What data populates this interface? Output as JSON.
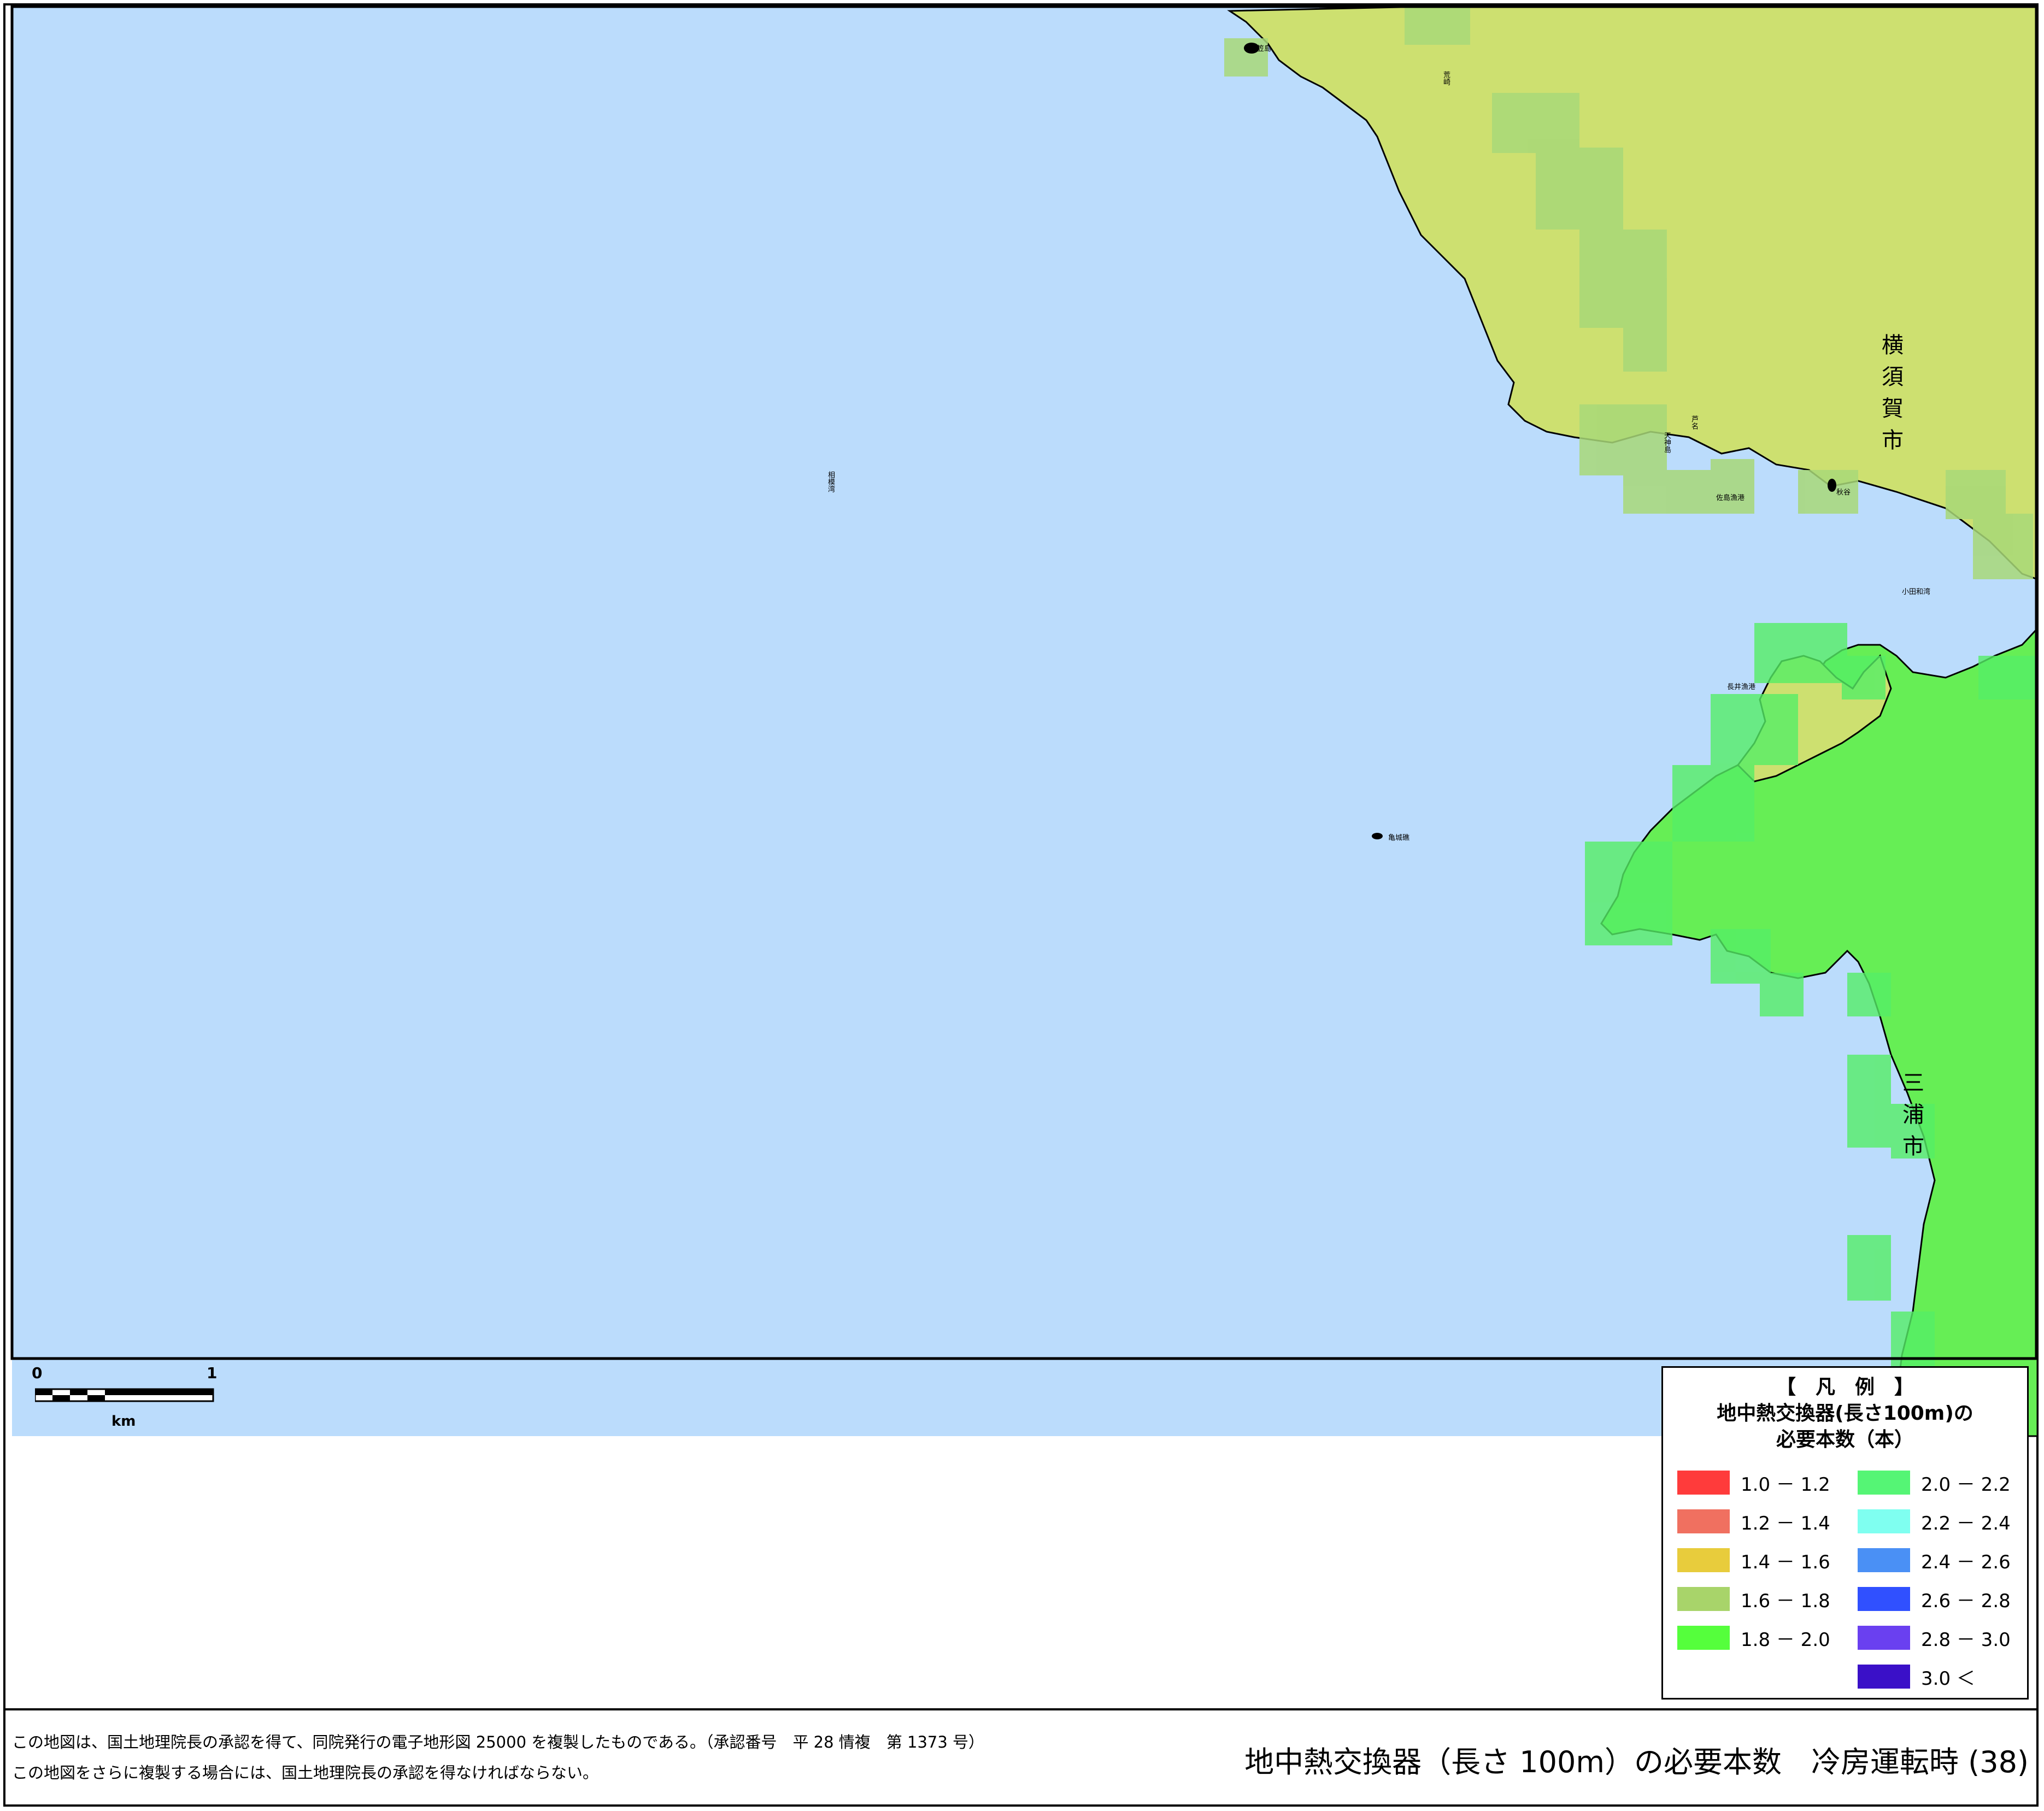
{
  "map": {
    "colors": {
      "sea": "#bbdcfc",
      "zone_1_6_1_8": "#cde070",
      "zone_1_8_2_0": "#66ee55",
      "zone_grid_1_6_1_8": "#a8d878",
      "zone_grid_1_8_2_0": "#55ee66",
      "outline": "#000000"
    },
    "place_labels": [
      "笠島",
      "荒崎",
      "亀城礁",
      "長井漁港",
      "佐島漁港",
      "天神島",
      "芦名",
      "相模湾",
      "小田和湾",
      "秋谷",
      "三浦市"
    ],
    "city_label_yokosuka": "横須賀市",
    "city_label_miura": "三浦市"
  },
  "scale_bar": {
    "tick_start": "0",
    "tick_end": "1",
    "unit": "km"
  },
  "legend": {
    "heading": "【　凡　例　】",
    "title_line1": "地中熱交換器(長さ100m)の",
    "title_line2": "必要本数（本）",
    "items": [
      {
        "range": "1.0 － 1.2",
        "color": "#ff3b3b"
      },
      {
        "range": "1.2 － 1.4",
        "color": "#f07060"
      },
      {
        "range": "1.4 － 1.6",
        "color": "#e8cc3c"
      },
      {
        "range": "1.6 － 1.8",
        "color": "#a8d46a"
      },
      {
        "range": "1.8 － 2.0",
        "color": "#55ff3c"
      },
      {
        "range": "2.0 － 2.2",
        "color": "#55f575"
      },
      {
        "range": "2.2 － 2.4",
        "color": "#7ffff0"
      },
      {
        "range": "2.4 － 2.6",
        "color": "#4a90f5"
      },
      {
        "range": "2.6 － 2.8",
        "color": "#3050ff"
      },
      {
        "range": "2.8 － 3.0",
        "color": "#6a40f0"
      },
      {
        "range": "3.0 ＜",
        "color": "#3a10c8"
      }
    ]
  },
  "footer": {
    "note_line1": "この地図は、国土地理院長の承認を得て、同院発行の電子地形図 25000 を複製したものである。（承認番号　平 28 情複　第 1373 号）",
    "note_line2": "この地図をさらに複製する場合には、国土地理院長の承認を得なければならない。",
    "title": "地中熱交換器（長さ 100m）の必要本数　冷房運転時 (38)"
  }
}
